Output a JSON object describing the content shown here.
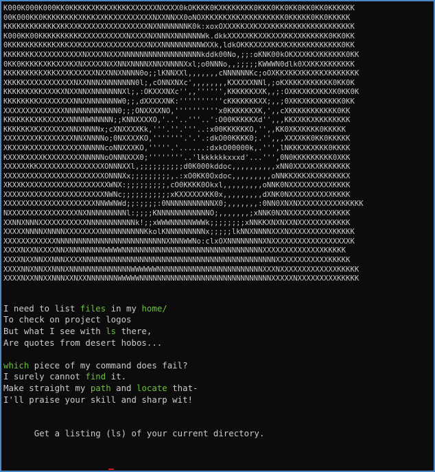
{
  "terminal": {
    "ascii_art": [
      "K000K000K000KK0KKKKKXKKKXKKKKXXXXXXNXXXX0kOKKKK0KXKKKKKKK0KKK0KK0KK0KK0KK0KKKKKK",
      "00K000KK0KKKKKKKKXKKKXXKKXXXXXXXXXNXXNNXX0oNOXKKXKKXKKXKKKKKKKKK0KKKKK0KK0KKKKK",
      "KKKKKKKKKKKKXKKXXKXXXXXXXXXXXXXXXNXNNNNNNNK0k:xoxOXXXKKXXKXXXKKKKKKKKKKKKKKKKKKK",
      "K000KK00KKKKKKKKKKXXXXXXXXXXNXXXXNXNNNXNNNNNNWk.dkkXXXXXKKXXKXXXKKXXKKKKKK0KK0KK",
      "0KKKKKKKKKKKXKKXXKXXXXXXXXXXXXXXXNXXNNNNNNNNNWXXk,ldkOKKKXXXXKKXKXKKKKKKKKKKK0KK",
      "KKKKKKKXXXXXXXXXXXNXXXXNXXXNNNNNNNNNNNNNNNNNNkddk00No,;;:oKNK00kOKXXXKKXKKKKKK0KK",
      "0KK0KKKKKXKKXXXKXNXXXXXNXXNNXNNNNXNNXNNNNXxl;o0NNNo,,;;;;;KWWWN0dlk0XXKKXKKKKKKK",
      "KKKKKKKKKXKKXXXKXXXXXNXXNNXNNNN0o;;lKNNXXl,,,,,,,cNNNNNNKc;oOXKKXKKXKKXKKXKKKKKKK",
      "XKKKKXXXXXXXXXXXNXXNNNXNNNNNNN0l;,cONNXNXc',,,,,,,,KXXXXXNNl,;oKXKKKXKKKKKK0KK0K",
      "KKKKKKXKKXXXKXNXXNNXNNNNNNNXl;,:OKXXXNXc'',,'''''',KKKKKKXXK,,;:OXKKXKKXKKXK0KK0K",
      "KKKKKKKKXXXXXXXXNNXNNNNNNNW0;;,dXXXXXNK:''''''''''cKKKKKKKXX;,,;0XKKXKKXKKKKK0KK",
      "XXXXXXXXXXXXXXNNNNNNNNNNNN0;;;ONXXXXNO,''''''''''x0KKKKKKXK,',,cXKKKKKKKKKKK0KK",
      "KKKKKKKXKKXXXXXNNNNWNNNNN;;KNNXXXXO,'..'..'''..':O00KKKKKXd'',,,KKXXKKXKKKKKKKK",
      "KKKKKKXKXXXXXXXNNXNNNNx;cXNXXXXKk,'''.''.'''..:x00KKKKKKO,'',,KK0XKXKKKK0KKKKK",
      "XXXXXXXXKXXXXXXXNNXNNNNo;0NXXXXKO,'''''''.'.'.:dkO00KKKK0;.'',,,XXXXKK0KK0KKKKK",
      "XKXXXKXXXXXXXXXXXXNNNNNcoNNXXXKO,'''''.'......:dxkO00000k,.''',lNKKKXKXKKK0KKKK",
      "KXXXKXXXXKXXXXXXXXNNNNNoONNNXXX0;''''''''..'lkkkkkkxxxd'...''',0N0KKKKKKKKK0XKK",
      "XXXXXXKKXXXXXXXXXXXXXXXONNNXXl,;;;;;;;;;;d0K000kddoc,,,,,,,,,,xNN0XXXXKXKKKKKKK",
      "XXXXXXXXXXXXXXXXXXXXXXXONNNXx;;;;;;;;;,.:xO0KK0Oxdoc,,,,,,,,,oNNKKXKKXKXKKKKKKX",
      "XKXXKXXXXXXXXXXXXXXXXXXXWNX:;;;;;;;;;,cO0KKKK0Okxl,,,,,,,,,oNNK0NXXXXXXXXXXKKKK",
      "XXXXXXXXXXXXXXXXXXXXXXXNWNc;;;;;;;;;;;xKXXXXXXKK0x,,,,,,,,,dXNK0NXXXXXXXXXXKKKK",
      "XXXXXXXXXXXXXXXXXXXXXNNWWNWd;;:;;;;:0NNNNNNNNNNNX0;,,,,,,,:0NN0XNXNXXXXXXXXXXKKKKK",
      "NXXXXXXXXXXXXXXXXNXNNNNNNNNNl:;;;;KNNNNNNNNNNNNO;,,,,,,,;xNNK0NXNXXXXXXXKXXKKKK",
      "XXNNXNNNXXXXXXXXXXXNNNNNNNNNNNk!;;xWWWNNNNNWWWk;;;;;;;;xNNKKXNXNXXNXXXXXXXKKKKK",
      "XXXXXNNNNXNNNNXXXXXXXXNNNNNNNNNNKkolKNNNNNNNNNx;;;;;lkNNXNNNNXXXNXXXXXXXXXXKKKKK",
      "XXXXXXXXXXXXNNNNNNNNNNNNNNNNNNNNNNNNNXNNNWWNo:clxOXNNNNNNNNXNXXXXXXXXXXXXXXXXXXK",
      "XXXXNXXNXXXXNNXNNNNNNNNWWWWNNNNNNNNNNNNNNNNNNNNNNNNNNNNNNNNXXXXXXXXXXXXXXKKKKK",
      "XXXXNXXNNXXNNNXXXXNNNNNNNNNNNNNNNNNNNNNNNNNNNNNNNNNNNNNNNNNNNNXXXXXXXXXXXXKKKKK",
      "XXXXNNXNNXXNNNXNNNNNNNNNNNNNNWWWWWWNNNNNNNNNNNNNNNNNNNNNNNNXXXNXXXXXXXXXXXXXKKKKK",
      "XXXXNXXNNXXNNNXXNXXNNNNNNNWWWWWNNNNNNNNNNNNNNNNNNNNNNNNNNNNNNXXXXXNXXXXXXXXXKKKKK"
    ],
    "poem": [
      [
        {
          "t": "I need to list "
        },
        {
          "t": "files",
          "hl": true
        },
        {
          "t": " in my "
        },
        {
          "t": "home/",
          "hl": true
        }
      ],
      [
        {
          "t": "To check on project logos"
        }
      ],
      [
        {
          "t": "But what I see with "
        },
        {
          "t": "ls",
          "hl": true
        },
        {
          "t": " there,"
        }
      ],
      [
        {
          "t": "Are quotes from desert hobos..."
        }
      ],
      [
        {
          "t": ""
        }
      ],
      [
        {
          "t": "which",
          "hl": true
        },
        {
          "t": " piece of my command does fail?"
        }
      ],
      [
        {
          "t": "I surely cannot "
        },
        {
          "t": "find",
          "hl": true
        },
        {
          "t": " it."
        }
      ],
      [
        {
          "t": "Make straight my "
        },
        {
          "t": "path",
          "hl": true
        },
        {
          "t": " and "
        },
        {
          "t": "locate",
          "hl": true
        },
        {
          "t": " that-"
        }
      ],
      [
        {
          "t": "I'll praise your skill and sharp wit!"
        }
      ]
    ],
    "prompt": "Get a listing (ls) of your current directory.",
    "colors": {
      "background": "#0c0c0c",
      "text": "#cccccc",
      "highlight": "#6fbf3f",
      "accent_red": "#d01e1e",
      "frame_border": "#4a88cc"
    }
  }
}
